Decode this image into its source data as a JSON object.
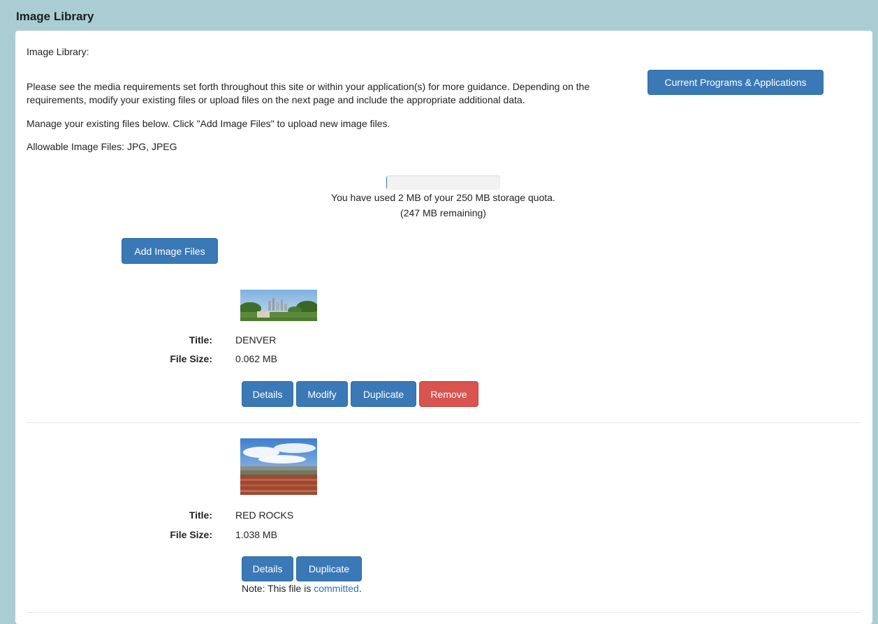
{
  "header": {
    "title": "Image Library"
  },
  "intro": {
    "heading": "Image Library:",
    "guidance": "Please see the media requirements set forth throughout this site or within your application(s) for more guidance. Depending on the requirements, modify your existing files or upload files on the next page and include the appropriate additional data.",
    "programs_button": "Current Programs & Applications",
    "manage": "Manage your existing files below. Click \"Add Image Files\" to upload new image files.",
    "allowable": "Allowable Image Files: JPG, JPEG"
  },
  "quota": {
    "used_fraction": 0.008,
    "used_text": "You have used 2 MB of your 250 MB storage quota.",
    "remaining_text": "(247 MB remaining)"
  },
  "add_button": "Add Image Files",
  "labels": {
    "title": "Title:",
    "file_size": "File Size:"
  },
  "files": [
    {
      "title": "DENVER",
      "size": "0.062 MB",
      "buttons": {
        "details": "Details",
        "modify": "Modify",
        "duplicate": "Duplicate",
        "remove": "Remove"
      }
    },
    {
      "title": "RED ROCKS",
      "size": "1.038 MB",
      "buttons": {
        "details": "Details",
        "duplicate": "Duplicate"
      },
      "note_prefix": "Note: This file is ",
      "note_link": "committed",
      "note_suffix": "."
    }
  ],
  "colors": {
    "primary": "#3b78b6",
    "danger": "#d9534f",
    "frame": "#a9cdd2"
  }
}
